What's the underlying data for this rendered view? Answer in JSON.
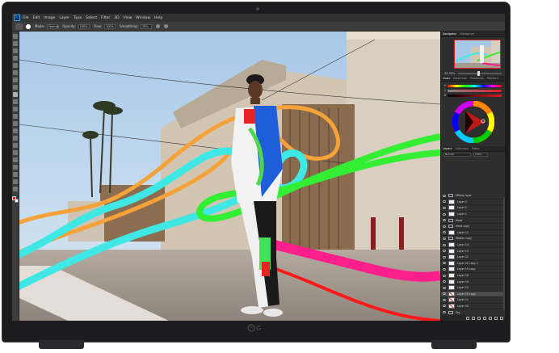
{
  "app": {
    "icon_label": "Ps",
    "menu": [
      "File",
      "Edit",
      "Image",
      "Layer",
      "Type",
      "Select",
      "Filter",
      "3D",
      "View",
      "Window",
      "Help"
    ]
  },
  "options_bar": {
    "mode_label": "Mode:",
    "mode_value": "Normal",
    "opacity_label": "Opacity:",
    "opacity_value": "100%",
    "flow_label": "Flow:",
    "flow_value": "100%",
    "smoothing_label": "Smoothing:",
    "smoothing_value": "10%"
  },
  "tools": {
    "count": 22,
    "active_index": 8,
    "foreground_color": "#e01b22",
    "background_color": "#ffffff"
  },
  "panels": {
    "navigator_tabs": [
      "Navigator",
      "Histogram"
    ],
    "zoom": "33.33%",
    "color_tabs": [
      "Color",
      "Swatches",
      "Gradients",
      "Patterns"
    ],
    "layers_tabs": [
      "Layers",
      "Channels",
      "Paths"
    ],
    "blend_mode": "Normal",
    "opacity": "100%",
    "layers": [
      {
        "name": "Effects layer",
        "type": "folder",
        "selected": false
      },
      {
        "name": "Layer 3",
        "type": "layer",
        "selected": false
      },
      {
        "name": "Layer 2",
        "type": "layer",
        "selected": false
      },
      {
        "name": "Layer 1",
        "type": "layer",
        "selected": false
      },
      {
        "name": "Head",
        "type": "folder",
        "selected": false
      },
      {
        "name": "Head copy",
        "type": "folder",
        "selected": false
      },
      {
        "name": "Layer 12",
        "type": "layer",
        "selected": false
      },
      {
        "name": "Ribbon copy",
        "type": "folder",
        "selected": false
      },
      {
        "name": "Layer 14",
        "type": "layer",
        "selected": false
      },
      {
        "name": "Layer 13",
        "type": "layer",
        "selected": false
      },
      {
        "name": "Layer 22",
        "type": "layer",
        "selected": false
      },
      {
        "name": "Layer 22 copy 2",
        "type": "layer",
        "selected": false
      },
      {
        "name": "Layer 19 copy",
        "type": "layer",
        "selected": false
      },
      {
        "name": "Layer 18",
        "type": "layer",
        "selected": false
      },
      {
        "name": "Layer 16",
        "type": "layer",
        "selected": false
      },
      {
        "name": "Layer 15",
        "type": "layer",
        "selected": false
      },
      {
        "name": "Layer 10 copy",
        "type": "painted",
        "selected": true
      },
      {
        "name": "Layer 11",
        "type": "painted",
        "selected": false
      },
      {
        "name": "Layer 10",
        "type": "painted",
        "selected": false
      },
      {
        "name": "Sky",
        "type": "folder",
        "selected": false
      }
    ]
  },
  "colors": {
    "ribbon_orange": "#f5a23a",
    "ribbon_cyan": "#3fe8e4",
    "ribbon_green": "#33ee33",
    "ribbon_pink": "#ff1f8c",
    "ribbon_red": "#ff1a1a",
    "ui_accent": "#31a8ff"
  }
}
